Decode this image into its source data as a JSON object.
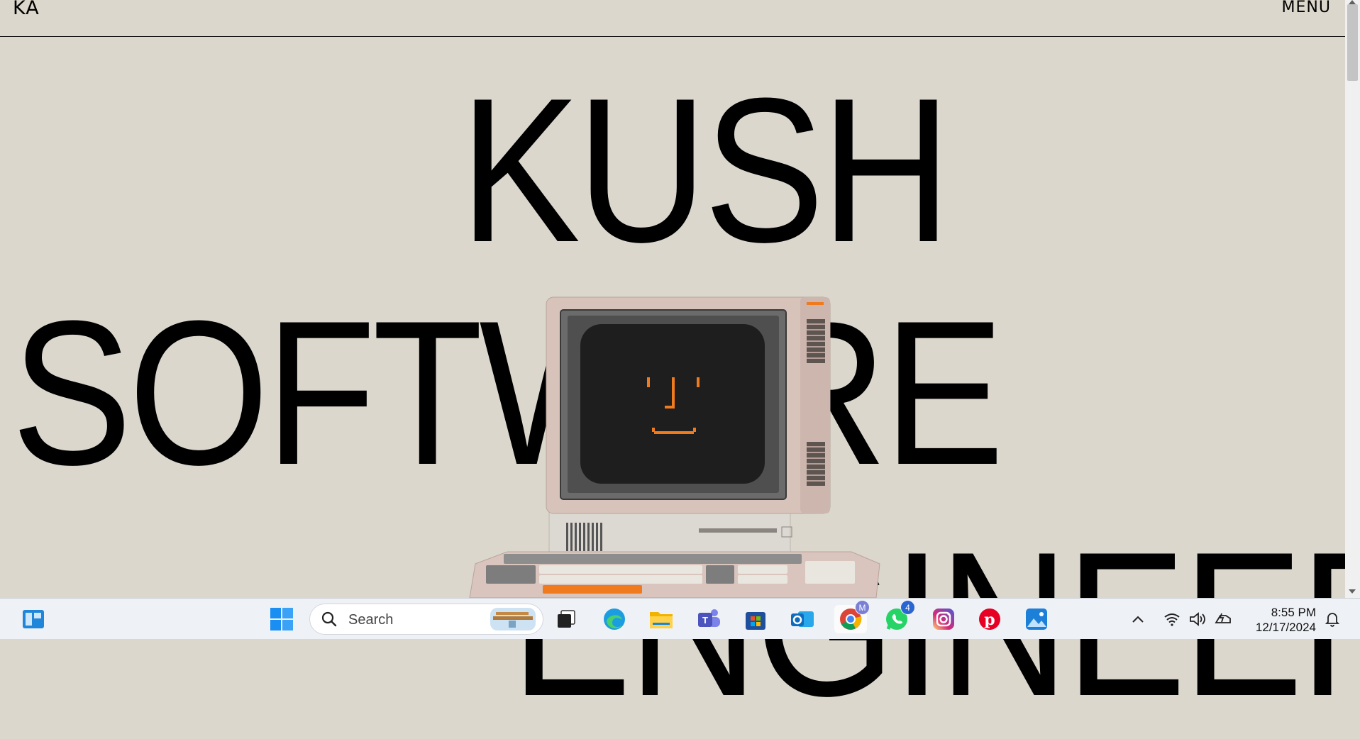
{
  "header": {
    "logo": "KA",
    "menu_label": "MENU"
  },
  "hero": {
    "line1": "KUSH",
    "line2": "SOFTWARE",
    "line3": "ENGINEER"
  },
  "taskbar": {
    "search_label": "Search",
    "chrome_badge": "M",
    "whatsapp_badge": "4",
    "time": "8:55 PM",
    "date": "12/17/2024"
  },
  "colors": {
    "background": "#dbd7cc",
    "screen_glow": "#f07a1e",
    "taskbar": "#eef1f6"
  }
}
